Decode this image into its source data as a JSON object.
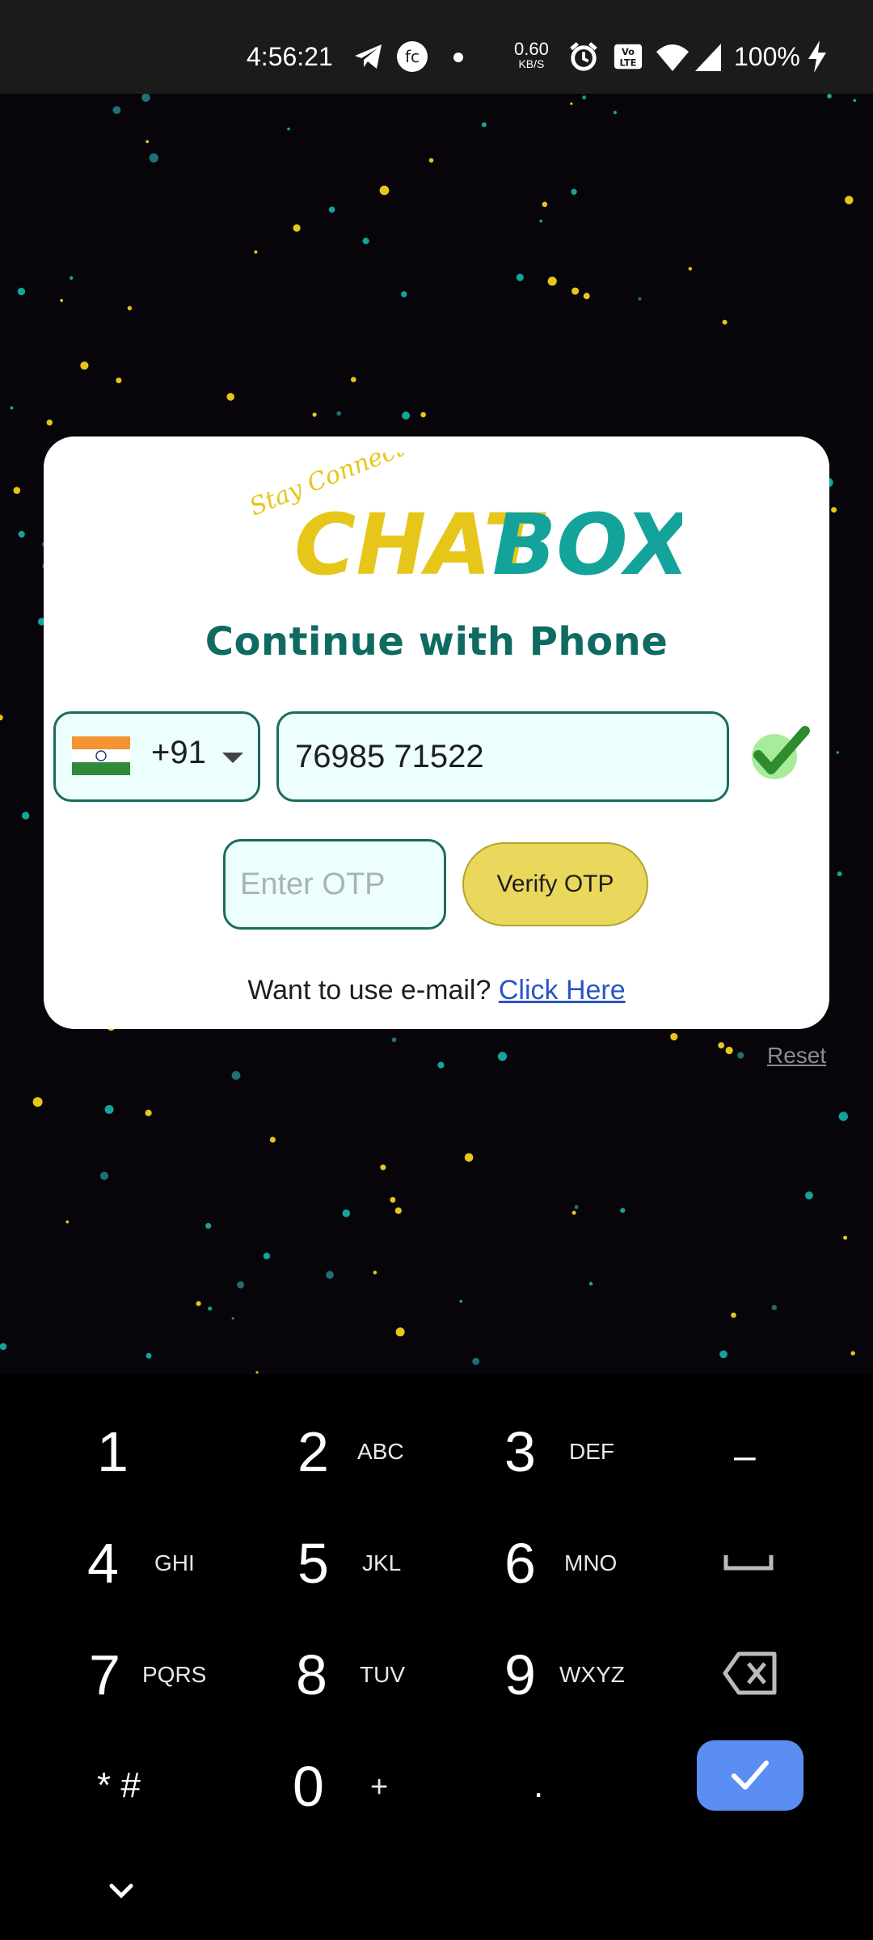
{
  "status_bar": {
    "time": "4:56:21",
    "speed_value": "0.60",
    "speed_unit": "KB/S",
    "battery": "100%",
    "icons": [
      "telegram-icon",
      "fc-app-icon",
      "notification-dot-icon",
      "alarm-icon",
      "volte-icon",
      "wifi-icon",
      "signal-icon",
      "charging-bolt-icon"
    ]
  },
  "card": {
    "logo_tagline": "Stay Connected!",
    "logo_word_1": "CHAT",
    "logo_word_2": "BOX",
    "title": "Continue with Phone",
    "country_code": "+91",
    "country_flag": "india-flag-icon",
    "phone_value": "76985 71522",
    "otp_placeholder": "Enter OTP",
    "verify_label": "Verify OTP",
    "email_prompt": "Want to use e-mail?",
    "email_link": "Click Here"
  },
  "reset_label": "Reset",
  "keyboard": {
    "keys": [
      {
        "num": "1",
        "letters": ""
      },
      {
        "num": "2",
        "letters": "ABC"
      },
      {
        "num": "3",
        "letters": "DEF"
      },
      {
        "num": "–",
        "letters": ""
      },
      {
        "num": "4",
        "letters": "GHI"
      },
      {
        "num": "5",
        "letters": "JKL"
      },
      {
        "num": "6",
        "letters": "MNO"
      },
      {
        "num": "␣",
        "letters": ""
      },
      {
        "num": "7",
        "letters": "PQRS"
      },
      {
        "num": "8",
        "letters": "TUV"
      },
      {
        "num": "9",
        "letters": "WXYZ"
      },
      {
        "num": "⌫",
        "letters": ""
      },
      {
        "num": "* #",
        "letters": ""
      },
      {
        "num": "0",
        "letters": "+"
      },
      {
        "num": ".",
        "letters": ""
      }
    ]
  },
  "colors": {
    "accent_teal": "#0f6b61",
    "logo_yellow": "#e6c619",
    "logo_teal": "#14a39a",
    "verify_yellow": "#ead85c",
    "enter_blue": "#5b8ef2"
  }
}
